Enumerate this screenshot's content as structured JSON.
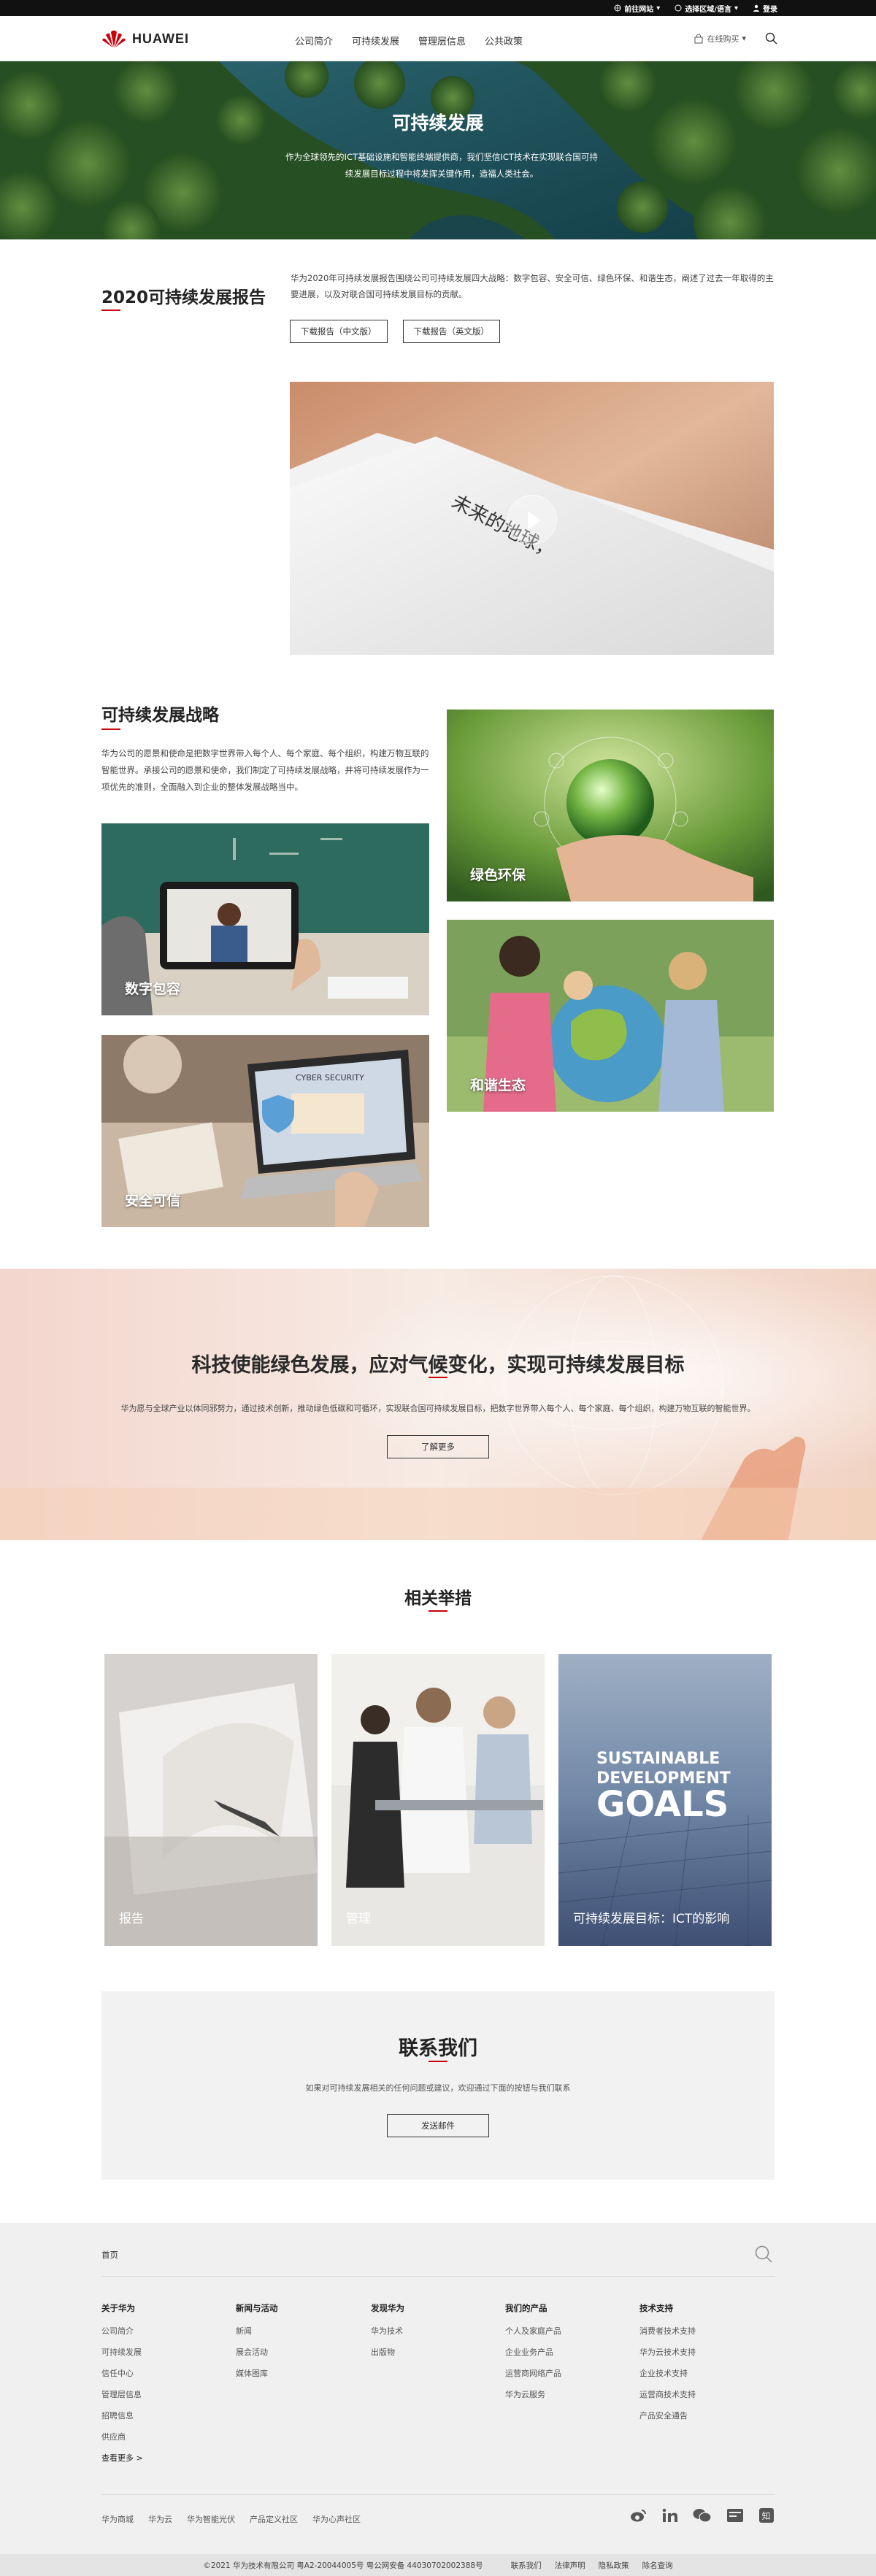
{
  "topbar": {
    "site_label": "前往网站",
    "region_label": "选择区域/语言",
    "login_label": "登录"
  },
  "header": {
    "logo_text": "HUAWEI",
    "nav": [
      "公司简介",
      "可持续发展",
      "管理层信息",
      "公共政策"
    ],
    "buy_label": "在线购买"
  },
  "hero": {
    "title": "可持续发展",
    "description": "作为全球领先的ICT基础设施和智能终端提供商，我们坚信ICT技术在实现联合国可持续发展目标过程中将发挥关键作用，造福人类社会。"
  },
  "report": {
    "title": "2020可持续发展报告",
    "description": "华为2020年可持续发展报告围绕公司可持续发展四大战略：数字包容、安全可信、绿色环保、和谐生态，阐述了过去一年取得的主要进展，以及对联合国可持续发展目标的贡献。",
    "btn_cn": "下载报告（中文版）",
    "btn_en": "下载报告（英文版）",
    "video_caption": "未来的地球，"
  },
  "strategy": {
    "title": "可持续发展战略",
    "description": "华为公司的愿景和使命是把数字世界带入每个人、每个家庭、每个组织，构建万物互联的智能世界。承接公司的愿景和使命，我们制定了可持续发展战略，并将可持续发展作为一项优先的准则，全面融入到企业的整体发展战略当中。",
    "tiles": [
      "数字包容",
      "安全可信",
      "绿色环保",
      "和谐生态"
    ],
    "tile_text": "CYBER SECURITY"
  },
  "tech": {
    "title": "科技使能绿色发展，应对气候变化，实现可持续发展目标",
    "description": "华为愿与全球产业以体同邪努力，通过技术创新，推动绿色低碳和可循环，实现联合国可持续发展目标，把数字世界带入每个人、每个家庭、每个组织，构建万物互联的智能世界。",
    "button": "了解更多"
  },
  "related": {
    "title": "相关举措",
    "cards": [
      "报告",
      "管理",
      "可持续发展目标：ICT的影响"
    ],
    "sdg_lines": [
      "SUSTAINABLE",
      "DEVELOPMENT",
      "GOALS"
    ]
  },
  "contact": {
    "title": "联系我们",
    "description": "如果对可持续发展相关的任何问题或建议，欢迎通过下面的按钮与我们联系",
    "button": "发送邮件"
  },
  "footer": {
    "home": "首页",
    "columns": [
      {
        "title": "关于华为",
        "items": [
          "公司简介",
          "可持续发展",
          "信任中心",
          "管理层信息",
          "招聘信息",
          "供应商",
          "查看更多 >"
        ]
      },
      {
        "title": "新闻与活动",
        "items": [
          "新闻",
          "展会活动",
          "媒体图库"
        ]
      },
      {
        "title": "发现华为",
        "items": [
          "华为技术",
          "出版物"
        ]
      },
      {
        "title": "我们的产品",
        "items": [
          "个人及家庭产品",
          "企业业务产品",
          "运营商网络产品",
          "华为云服务"
        ]
      },
      {
        "title": "技术支持",
        "items": [
          "消费者技术支持",
          "华为云技术支持",
          "企业技术支持",
          "运营商技术支持",
          "产品安全通告"
        ]
      }
    ],
    "bottom_links": [
      "华为商城",
      "华为云",
      "华为智能光伏",
      "产品定义社区",
      "华为心声社区"
    ],
    "copyright": "©2021 华为技术有限公司 粤A2-20044005号 粤公网安备 44030702002388号",
    "legal": [
      "联系我们",
      "法律声明",
      "隐私政策",
      "除名查询"
    ]
  },
  "colors": {
    "accent": "#c7000b"
  }
}
